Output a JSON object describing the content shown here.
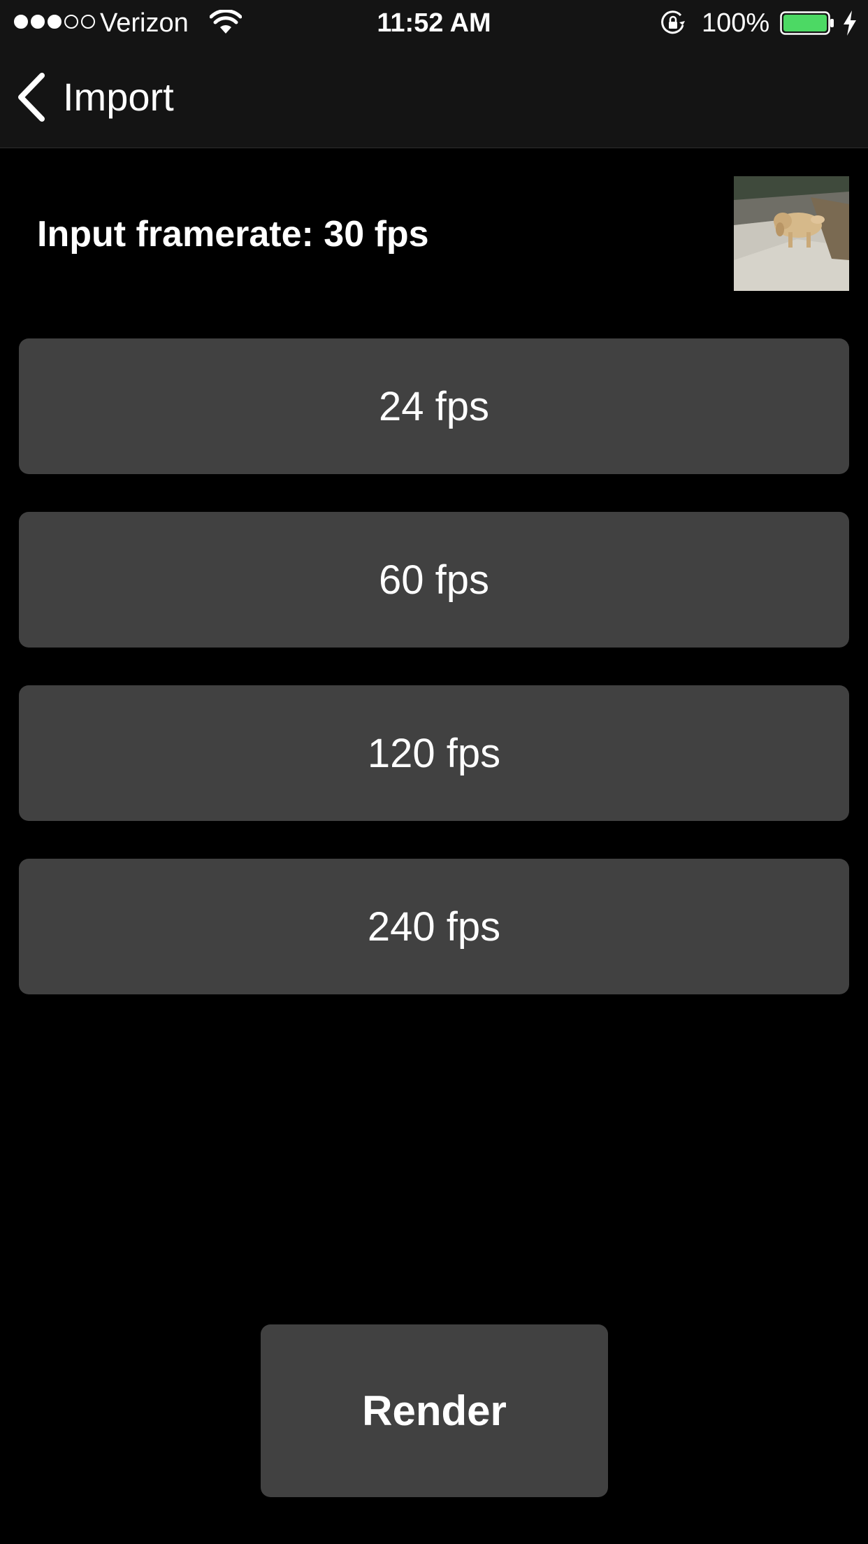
{
  "status_bar": {
    "carrier": "Verizon",
    "signal_bars_filled": 3,
    "signal_bars_total": 5,
    "time": "11:52 AM",
    "battery_percent": "100%",
    "battery_level": 1.0,
    "battery_color": "#4cd964",
    "icons": [
      "wifi-icon",
      "orientation-lock-icon",
      "battery-icon",
      "charging-icon"
    ]
  },
  "nav": {
    "back_label": "Import",
    "back_icon": "chevron-left-icon"
  },
  "main": {
    "input_framerate": "Input framerate: 30 fps",
    "fps_options": [
      {
        "label": "24 fps"
      },
      {
        "label": "60 fps"
      },
      {
        "label": "120 fps"
      },
      {
        "label": "240 fps"
      }
    ],
    "render_label": "Render"
  },
  "colors": {
    "background": "#000000",
    "bar_background": "#141414",
    "button_background": "#414141",
    "text": "#ffffff"
  }
}
